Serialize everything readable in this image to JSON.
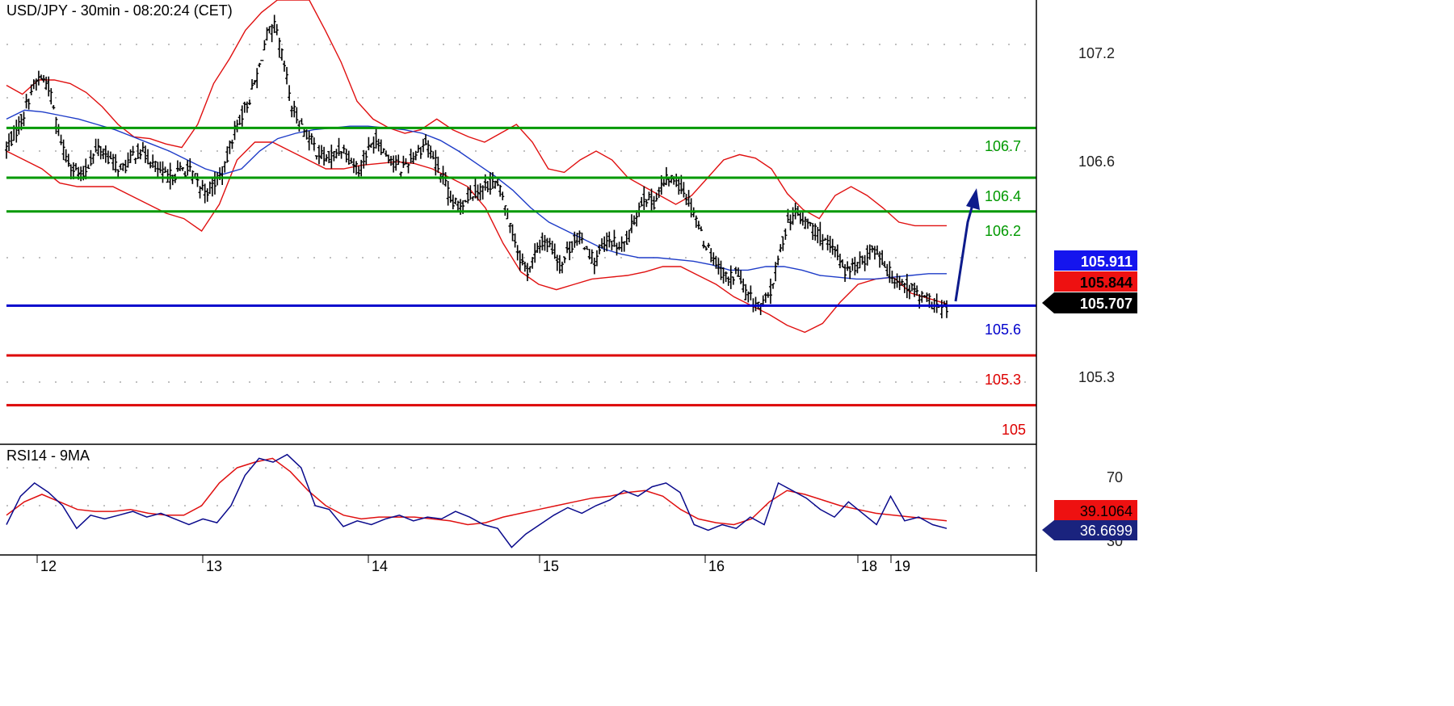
{
  "chart_data": {
    "type": "line",
    "title": "USD/JPY - 30min - 08:20:24 (CET)",
    "x_labels": [
      "12",
      "13",
      "14",
      "15",
      "16",
      "18",
      "19"
    ],
    "price_panel": {
      "y_ticks": [
        "107.2",
        "106.6",
        "105.3"
      ],
      "ylim": [
        104.95,
        107.45
      ],
      "grid": true,
      "resistance_levels": [
        {
          "label": "106.7",
          "value": 106.73,
          "color": "#009900"
        },
        {
          "label": "106.4",
          "value": 106.45,
          "color": "#009900"
        },
        {
          "label": "106.2",
          "value": 106.26,
          "color": "#009900"
        }
      ],
      "support_levels": [
        {
          "label": "105.6",
          "value": 105.73,
          "color": "#0000cc"
        },
        {
          "label": "105.3",
          "value": 105.45,
          "color": "#dd0000"
        },
        {
          "label": "105",
          "value": 105.17,
          "color": "#dd0000"
        }
      ],
      "price_tags": [
        {
          "label": "105.911",
          "value": 105.911,
          "bg": "#1515ee",
          "fg": "#ffffff",
          "arrow": false
        },
        {
          "label": "105.844",
          "value": 105.844,
          "bg": "#ee1111",
          "fg": "#000000",
          "arrow": false
        },
        {
          "label": "105.707",
          "value": 105.707,
          "bg": "#000000",
          "fg": "#ffffff",
          "arrow": true
        }
      ],
      "close_series": {
        "name": "",
        "values": [
          106.62,
          106.7,
          106.8,
          106.95,
          107.02,
          106.97,
          106.75,
          106.58,
          106.5,
          106.45,
          106.55,
          106.62,
          106.57,
          106.52,
          106.5,
          106.58,
          106.6,
          106.55,
          106.5,
          106.45,
          106.47,
          106.5,
          106.48,
          106.4,
          106.38,
          106.43,
          106.5,
          106.7,
          106.8,
          106.9,
          107.05,
          107.25,
          107.3,
          107.1,
          106.85,
          106.75,
          106.68,
          106.6,
          106.55,
          106.58,
          106.62,
          106.55,
          106.5,
          106.6,
          106.67,
          106.6,
          106.55,
          106.5,
          106.55,
          106.6,
          106.65,
          106.55,
          106.45,
          106.3,
          106.3,
          106.35,
          106.38,
          106.4,
          106.43,
          106.36,
          106.2,
          106.02,
          105.92,
          106.02,
          106.1,
          106.05,
          105.95,
          106.05,
          106.12,
          106.07,
          105.98,
          106.05,
          106.1,
          106.05,
          106.1,
          106.25,
          106.35,
          106.3,
          106.4,
          106.45,
          106.42,
          106.35,
          106.25,
          106.1,
          106.02,
          105.93,
          105.88,
          105.92,
          105.8,
          105.75,
          105.73,
          105.8,
          106.0,
          106.2,
          106.25,
          106.2,
          106.18,
          106.12,
          106.05,
          106.02,
          105.92,
          105.95,
          105.98,
          106.05,
          106.02,
          105.92,
          105.88,
          105.85,
          105.82,
          105.78,
          105.75,
          105.72,
          105.71
        ]
      },
      "ma_series": {
        "name": "",
        "values": [
          106.78,
          106.83,
          106.82,
          106.8,
          106.78,
          106.75,
          106.72,
          106.68,
          106.64,
          106.6,
          106.55,
          106.5,
          106.47,
          106.5,
          106.6,
          106.67,
          106.7,
          106.72,
          106.73,
          106.74,
          106.74,
          106.73,
          106.72,
          106.7,
          106.66,
          106.6,
          106.53,
          106.46,
          106.38,
          106.28,
          106.2,
          106.15,
          106.1,
          106.05,
          106.02,
          106.0,
          106.0,
          105.99,
          105.98,
          105.96,
          105.93,
          105.93,
          105.95,
          105.95,
          105.93,
          105.9,
          105.89,
          105.88,
          105.88,
          105.89,
          105.9,
          105.91,
          105.91
        ]
      },
      "bollinger_upper": [
        106.97,
        106.92,
        107.0,
        107.0,
        106.98,
        106.93,
        106.85,
        106.75,
        106.68,
        106.67,
        106.64,
        106.62,
        106.75,
        106.98,
        107.12,
        107.28,
        107.38,
        107.45,
        107.45,
        107.45,
        107.28,
        107.1,
        106.88,
        106.78,
        106.73,
        106.7,
        106.72,
        106.78,
        106.72,
        106.68,
        106.65,
        106.7,
        106.75,
        106.65,
        106.5,
        106.48,
        106.55,
        106.6,
        106.55,
        106.45,
        106.4,
        106.35,
        106.3,
        106.35,
        106.45,
        106.55,
        106.58,
        106.56,
        106.5,
        106.36,
        106.27,
        106.22,
        106.35,
        106.4,
        106.35,
        106.28,
        106.2,
        106.18,
        106.18,
        106.18
      ],
      "bollinger_lower": [
        106.6,
        106.55,
        106.5,
        106.42,
        106.4,
        106.4,
        106.4,
        106.35,
        106.3,
        106.25,
        106.22,
        106.15,
        106.3,
        106.55,
        106.65,
        106.65,
        106.6,
        106.55,
        106.5,
        106.5,
        106.52,
        106.53,
        106.54,
        106.53,
        106.5,
        106.45,
        106.4,
        106.28,
        106.08,
        105.92,
        105.85,
        105.82,
        105.85,
        105.88,
        105.89,
        105.9,
        105.92,
        105.95,
        105.95,
        105.9,
        105.85,
        105.78,
        105.73,
        105.68,
        105.62,
        105.58,
        105.63,
        105.75,
        105.85,
        105.88,
        105.89,
        105.8,
        105.77,
        105.74
      ]
    },
    "rsi_panel": {
      "title": "RSI14 - 9MA",
      "y_ticks": [
        "70",
        "30"
      ],
      "ylim": [
        24,
        82
      ],
      "grid": true,
      "rsi_series": {
        "name": "",
        "values": [
          40,
          55,
          62,
          57,
          50,
          38,
          45,
          43,
          45,
          47,
          44,
          46,
          43,
          40,
          43,
          41,
          50,
          66,
          75,
          73,
          77,
          70,
          50,
          48,
          39,
          42,
          40,
          43,
          45,
          42,
          44,
          43,
          47,
          44,
          40,
          38,
          28,
          35,
          40,
          45,
          49,
          46,
          50,
          53,
          58,
          55,
          60,
          62,
          57,
          40,
          37,
          40,
          38,
          44,
          40,
          62,
          58,
          54,
          48,
          44,
          52,
          46,
          40,
          55,
          42,
          44,
          40,
          38
        ]
      },
      "ma_series": {
        "name": "",
        "values": [
          45,
          52,
          56,
          52,
          48,
          47,
          47,
          48,
          46,
          45,
          45,
          50,
          62,
          70,
          73,
          75,
          68,
          58,
          50,
          45,
          43,
          44,
          44,
          44,
          43,
          42,
          40,
          41,
          44,
          46,
          48,
          50,
          52,
          54,
          55,
          57,
          58,
          55,
          48,
          43,
          41,
          40,
          43,
          52,
          58,
          56,
          53,
          50,
          48,
          46,
          45,
          44,
          43,
          42
        ]
      },
      "price_tags": [
        {
          "label": "39.1064",
          "value": 46,
          "bg": "#ee1111",
          "fg": "#000000",
          "arrow": false
        },
        {
          "label": "36.6699",
          "value": 40,
          "bg": "#1a237e",
          "fg": "#ffffff",
          "arrow": true
        }
      ]
    },
    "colors": {
      "price_bars": "#000000",
      "moving_average": "#1e3cc8",
      "bollinger_bands": "#e01010",
      "rsi_line": "#0a0a8c",
      "rsi_ma": "#e01010",
      "forecast_arrow": "#0d1b8c",
      "grid_dots": "#9a9a9a"
    }
  }
}
